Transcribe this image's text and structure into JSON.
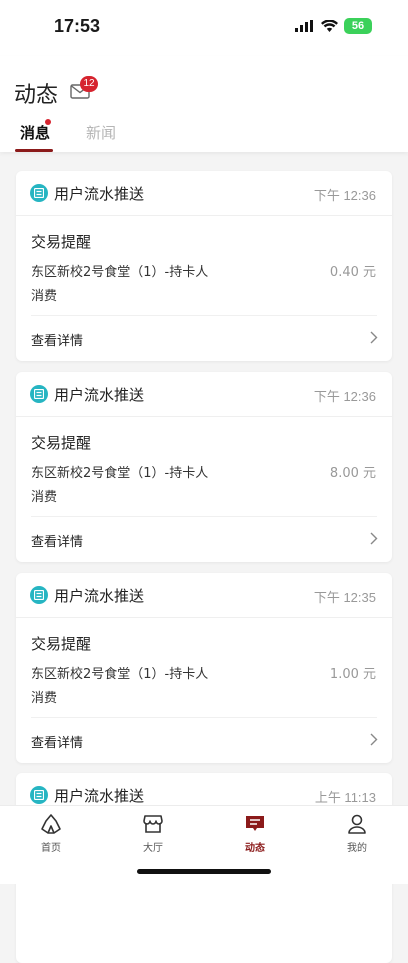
{
  "status_bar": {
    "time": "17:53",
    "battery": "56"
  },
  "header": {
    "title": "动态",
    "mail_badge": "12",
    "tabs": [
      {
        "label": "消息",
        "active": true,
        "has_dot": true
      },
      {
        "label": "新闻",
        "active": false
      }
    ]
  },
  "messages": [
    {
      "source": "用户流水推送",
      "time": "下午 12:36",
      "title": "交易提醒",
      "merchant": "东区新校2号食堂（1）-持卡人",
      "amount": "0.40 元",
      "type": "消费",
      "detail_label": "查看详情"
    },
    {
      "source": "用户流水推送",
      "time": "下午 12:36",
      "title": "交易提醒",
      "merchant": "东区新校2号食堂（1）-持卡人",
      "amount": "8.00 元",
      "type": "消费",
      "detail_label": "查看详情"
    },
    {
      "source": "用户流水推送",
      "time": "下午 12:35",
      "title": "交易提醒",
      "merchant": "东区新校2号食堂（1）-持卡人",
      "amount": "1.00 元",
      "type": "消费",
      "detail_label": "查看详情"
    },
    {
      "source": "用户流水推送",
      "time": "上午 11:13",
      "unread": true
    }
  ],
  "bottom_nav": [
    {
      "label": "首页",
      "icon": "home-icon",
      "active": false
    },
    {
      "label": "大厅",
      "icon": "shop-icon",
      "active": false
    },
    {
      "label": "动态",
      "icon": "message-icon",
      "active": true
    },
    {
      "label": "我的",
      "icon": "user-icon",
      "active": false
    }
  ],
  "colors": {
    "accent": "#8b1a1a",
    "badge": "#d6242f",
    "source_icon": "#26b5c2",
    "battery": "#3bd15a"
  }
}
